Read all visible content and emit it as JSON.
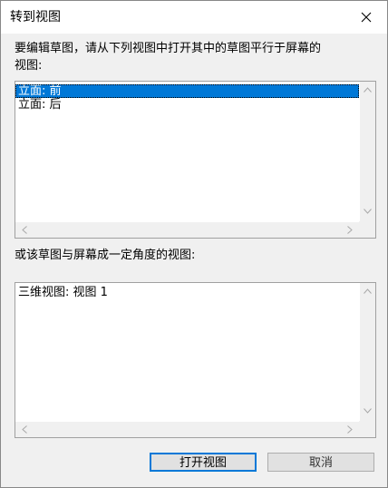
{
  "window": {
    "title": "转到视图"
  },
  "prompt_top": "要编辑草图，请从下列视图中打开其中的草图平行于屏幕的视图:",
  "prompt_top_line1": "要编辑草图，请从下列视图中打开其中的草图平行于屏幕的",
  "prompt_top_line2": "视图:",
  "list_parallel": {
    "items": [
      {
        "label": "立面: 前",
        "selected": true
      },
      {
        "label": "立面: 后",
        "selected": false
      }
    ]
  },
  "prompt_bottom": "或该草图与屏幕成一定角度的视图:",
  "list_angled": {
    "items": [
      {
        "label": "三维视图: 视图 1",
        "selected": false
      }
    ]
  },
  "buttons": {
    "open": "打开视图",
    "cancel": "取消"
  },
  "icons": {
    "close": "close-icon",
    "scroll_up": "chevron-up-icon",
    "scroll_down": "chevron-down-icon",
    "scroll_left": "chevron-left-icon",
    "scroll_right": "chevron-right-icon"
  },
  "colors": {
    "selection": "#0078d7",
    "dialog_bg": "#f0f0f0"
  }
}
